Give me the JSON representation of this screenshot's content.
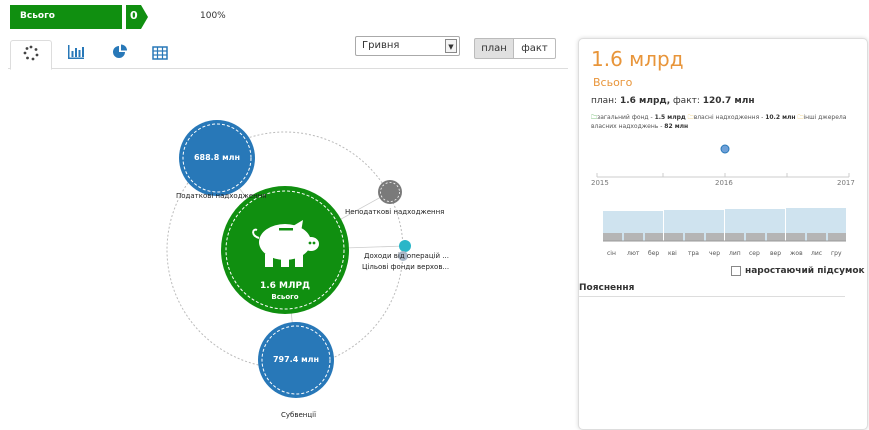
{
  "breadcrumb": {
    "label": "Всього",
    "count": "0",
    "percent": "100%",
    "color": "#108f10"
  },
  "tabs": [
    {
      "id": "bubbles",
      "icon": "bubble-chart-icon",
      "active": true
    },
    {
      "id": "bars",
      "icon": "bar-chart-icon",
      "active": false
    },
    {
      "id": "pie",
      "icon": "pie-chart-icon",
      "active": false
    },
    {
      "id": "table",
      "icon": "table-icon",
      "active": false
    }
  ],
  "currency": {
    "selected": "Гривня"
  },
  "toggle": {
    "plan": "план",
    "fact": "факт"
  },
  "colors": {
    "accent_blue": "#2878b8",
    "green": "#108f10",
    "orange": "#e8953a",
    "grey": "#7a7a7a",
    "teal": "#2ab6c8"
  },
  "chart": {
    "center": {
      "value": "1.6 МЛРД",
      "label": "Всього"
    },
    "nodes": [
      {
        "label": "Податкові надходження",
        "value": "688.8 млн"
      },
      {
        "label": "Субвенції",
        "value": "797.4 млн"
      },
      {
        "label": "Неподаткові надходження",
        "value": ""
      },
      {
        "label": "Доходи від операцій ...",
        "value": ""
      },
      {
        "label": "Цільові фонди верхов...",
        "value": ""
      }
    ]
  },
  "panel": {
    "title": "1.6 млрд",
    "subtitle": "Всього",
    "plan_label": "план:",
    "plan_value": "1.6 млрд,",
    "fact_label": "факт:",
    "fact_value": "120.7 млн",
    "legend": [
      {
        "label": "загальний фонд -",
        "value": "1.5 млрд"
      },
      {
        "label": "власні надходження -",
        "value": "10.2 млн"
      },
      {
        "label": "інші джерела власних надходжень -",
        "value": "82 млн"
      }
    ],
    "years": [
      "2015",
      "2016",
      "2017"
    ],
    "months": [
      "сін",
      "лют",
      "бер",
      "кві",
      "тра",
      "чер",
      "лип",
      "сер",
      "вер",
      "жов",
      "лис",
      "гру"
    ],
    "cumulative_label": "наростаючий підсумок",
    "explanation_title": "Пояснення"
  }
}
